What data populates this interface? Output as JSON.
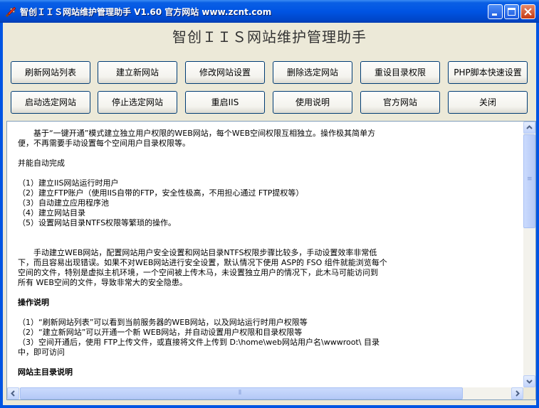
{
  "window": {
    "title": "智创ＩＩＳ网站维护管理助手 V1.60 官方网站 www.zcnt.com"
  },
  "app": {
    "heading": "智创ＩＩＳ网站维护管理助手"
  },
  "toolbar": {
    "row1": [
      "刷新网站列表",
      "建立新网站",
      "修改网站设置",
      "删除选定网站",
      "重设目录权限",
      "PHP脚本快速设置"
    ],
    "row2": [
      "启动选定网站",
      "停止选定网站",
      "重启IIS",
      "使用说明",
      "官方网站",
      "关闭"
    ]
  },
  "content": {
    "lines": [
      "　　基于“一键开通”模式建立独立用户权限的WEB网站，每个WEB空间权限互相独立。操作极其简单方",
      "便，不再需要手动设置每个空间用户目录权限等。",
      "",
      "并能自动完成",
      "",
      "（1）建立IIS网站运行时用户",
      "（2）建立FTP账户（使用IIS自带的FTP，安全性极高，不用担心通过 FTP提权等）",
      "（3）自动建立应用程序池",
      "（4）建立网站目录",
      "（5）设置网站目录NTFS权限等繁琐的操作。",
      "",
      "",
      "　　手动建立WEB网站，配置网站用户安全设置和网站目录NTFS权限步骤比较多，手动设置效率非常低",
      "下，而且容易出现错误。如果不对WEB网站进行安全设置，默认情况下使用 ASP的 FSO 组件就能浏览每个",
      "空间的文件，特别是虚拟主机环境，一个空间被上传木马，未设置独立用户的情况下，此木马可能访问到",
      "所有 WEB空间的文件，导致非常大的安全隐患。",
      "",
      "操作说明",
      "",
      "（1）“刷新网站列表”可以看到当前服务器的WEB网站，以及网站运行时用户权限等",
      "（2）“建立新网站”可以开通一个新 WEB网站，并自动设置用户权限和目录权限等",
      "（3）空间开通后，使用 FTP上传文件，或直接将文件上传到 D:\\home\\web网站用户名\\wwwroot\\ 目录",
      "中，即可访问",
      "",
      "网站主目录说明"
    ],
    "bold_lines": [
      17,
      24
    ]
  },
  "icons": {
    "app": "tools-icon",
    "minimize": "minimize-icon",
    "maximize": "maximize-icon",
    "close": "close-icon",
    "scroll_up": "arrow-up-icon",
    "scroll_down": "arrow-down-icon",
    "scroll_left": "arrow-left-icon",
    "scroll_right": "arrow-right-icon"
  },
  "colors": {
    "titlebar": "#0054e3",
    "window_bg": "#ece9d8",
    "button_border": "#003c74",
    "text_bg": "#ffffff"
  }
}
